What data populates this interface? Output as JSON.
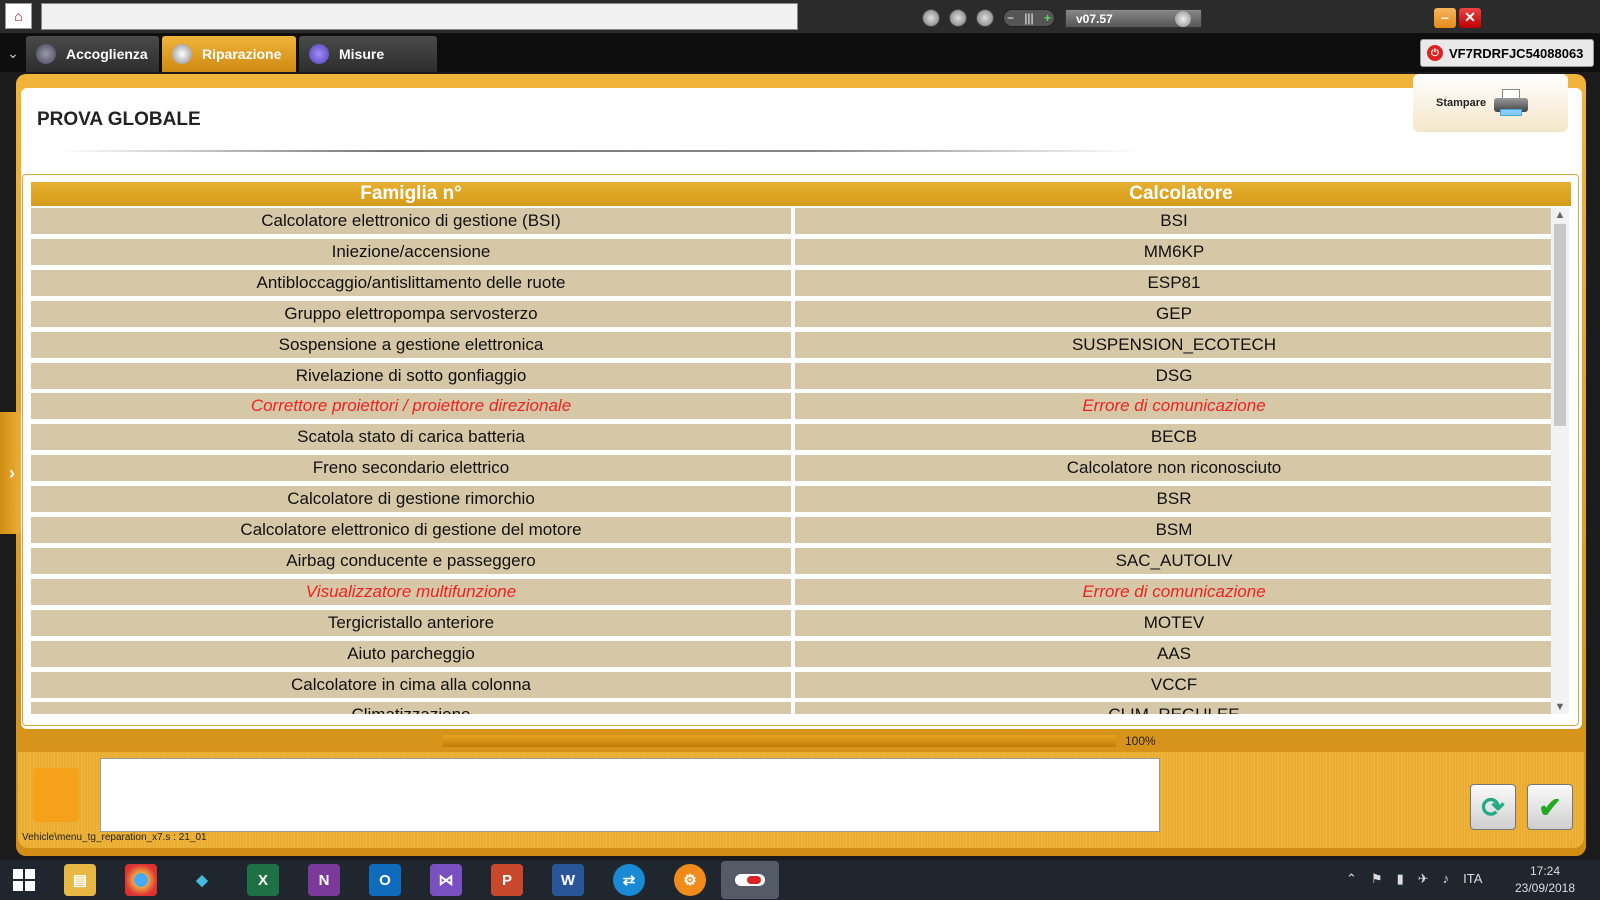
{
  "window": {
    "version": "v07.57",
    "vin": "VF7RDRFJC54088063"
  },
  "tabs": [
    {
      "label": "Accoglienza"
    },
    {
      "label": "Riparazione"
    },
    {
      "label": "Misure"
    }
  ],
  "page": {
    "title": "PROVA GLOBALE",
    "print_label": "Stampare"
  },
  "table": {
    "headers": [
      "Famiglia n°",
      "Calcolatore"
    ],
    "rows": [
      {
        "family": "Calcolatore elettronico di gestione (BSI)",
        "ecu": "BSI",
        "error": false
      },
      {
        "family": "Iniezione/accensione",
        "ecu": "MM6KP",
        "error": false
      },
      {
        "family": "Antibloccaggio/antislittamento delle ruote",
        "ecu": "ESP81",
        "error": false
      },
      {
        "family": "Gruppo elettropompa servosterzo",
        "ecu": "GEP",
        "error": false
      },
      {
        "family": "Sospensione a gestione elettronica",
        "ecu": "SUSPENSION_ECOTECH",
        "error": false
      },
      {
        "family": "Rivelazione di sotto gonfiaggio",
        "ecu": "DSG",
        "error": false
      },
      {
        "family": "Correttore proiettori / proiettore direzionale",
        "ecu": "Errore di comunicazione",
        "error": true
      },
      {
        "family": "Scatola stato di carica batteria",
        "ecu": "BECB",
        "error": false
      },
      {
        "family": "Freno secondario elettrico",
        "ecu": "Calcolatore non riconosciuto",
        "error": false
      },
      {
        "family": "Calcolatore di gestione rimorchio",
        "ecu": "BSR",
        "error": false
      },
      {
        "family": "Calcolatore elettronico di gestione del motore",
        "ecu": "BSM",
        "error": false
      },
      {
        "family": "Airbag conducente e passeggero",
        "ecu": "SAC_AUTOLIV",
        "error": false
      },
      {
        "family": "Visualizzatore multifunzione",
        "ecu": "Errore di comunicazione",
        "error": true
      },
      {
        "family": "Tergicristallo anteriore",
        "ecu": "MOTEV",
        "error": false
      },
      {
        "family": "Aiuto parcheggio",
        "ecu": "AAS",
        "error": false
      },
      {
        "family": "Calcolatore in cima alla colonna",
        "ecu": "VCCF",
        "error": false
      },
      {
        "family": "Climatizzazione",
        "ecu": "CLIM_REGULEE",
        "error": false
      }
    ]
  },
  "progress": {
    "value": 1.0,
    "label": "100%"
  },
  "status_path": "Vehicle\\menu_tg_reparation_x7.s : 21_01",
  "taskbar": {
    "language": "ITA",
    "time": "17:24",
    "date": "23/09/2018"
  },
  "colors": {
    "accent": "#f0b43a",
    "header": "#dca224",
    "cell": "#d6c8a7",
    "error_text": "#e22222"
  }
}
